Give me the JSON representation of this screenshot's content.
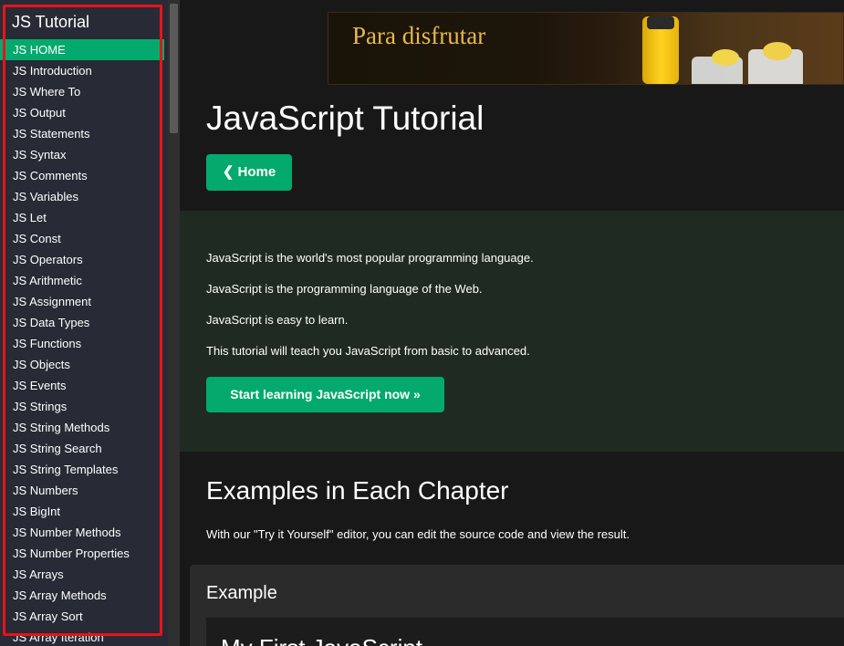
{
  "sidebar": {
    "title": "JS Tutorial",
    "items": [
      {
        "label": "JS HOME",
        "active": true
      },
      {
        "label": "JS Introduction"
      },
      {
        "label": "JS Where To"
      },
      {
        "label": "JS Output"
      },
      {
        "label": "JS Statements"
      },
      {
        "label": "JS Syntax"
      },
      {
        "label": "JS Comments"
      },
      {
        "label": "JS Variables"
      },
      {
        "label": "JS Let"
      },
      {
        "label": "JS Const"
      },
      {
        "label": "JS Operators"
      },
      {
        "label": "JS Arithmetic"
      },
      {
        "label": "JS Assignment"
      },
      {
        "label": "JS Data Types"
      },
      {
        "label": "JS Functions"
      },
      {
        "label": "JS Objects"
      },
      {
        "label": "JS Events"
      },
      {
        "label": "JS Strings"
      },
      {
        "label": "JS String Methods"
      },
      {
        "label": "JS String Search"
      },
      {
        "label": "JS String Templates"
      },
      {
        "label": "JS Numbers"
      },
      {
        "label": "JS BigInt"
      },
      {
        "label": "JS Number Methods"
      },
      {
        "label": "JS Number Properties"
      },
      {
        "label": "JS Arrays"
      },
      {
        "label": "JS Array Methods"
      },
      {
        "label": "JS Array Sort"
      },
      {
        "label": "JS Array Iteration"
      }
    ]
  },
  "ad": {
    "text": "Para disfrutar"
  },
  "main": {
    "title": "JavaScript Tutorial",
    "home_button": "❮ Home",
    "intro": [
      "JavaScript is the world's most popular programming language.",
      "JavaScript is the programming language of the Web.",
      "JavaScript is easy to learn.",
      "This tutorial will teach you JavaScript from basic to advanced."
    ],
    "start_button": "Start learning JavaScript now »",
    "examples_title": "Examples in Each Chapter",
    "examples_desc": "With our \"Try it Yourself\" editor, you can edit the source code and view the result.",
    "example_label": "Example",
    "example_code_title": "My First JavaScript"
  },
  "colors": {
    "accent": "#04aa6d",
    "highlight_border": "#e5141b",
    "sidebar_bg": "#282a35",
    "main_bg": "#181818"
  }
}
